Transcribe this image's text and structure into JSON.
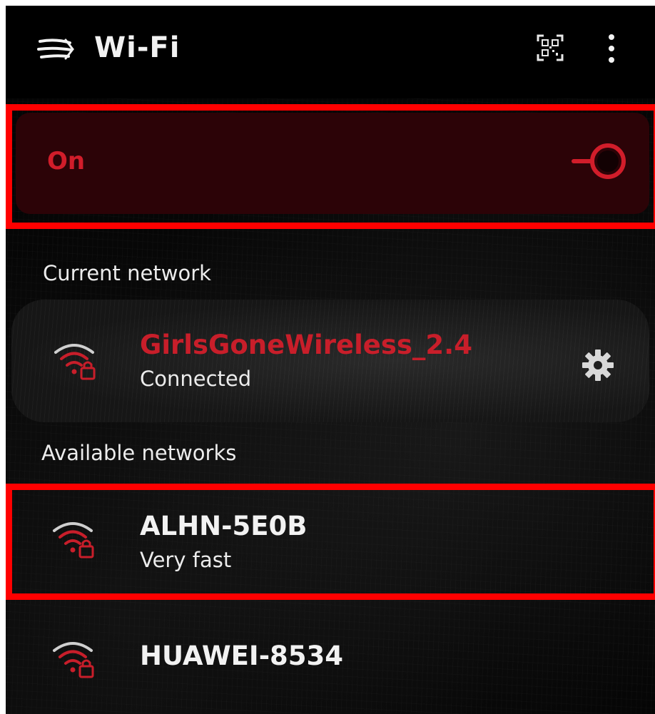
{
  "header": {
    "title": "Wi-Fi",
    "menu_icon": "menu-icon",
    "qr_icon": "qr-code-scan-icon",
    "more_icon": "more-vertical-icon"
  },
  "toggle": {
    "label": "On",
    "state": "on",
    "accent_color": "#d11d2a",
    "panel_color": "#2c0307"
  },
  "sections": {
    "current": "Current network",
    "available": "Available networks"
  },
  "current_network": {
    "name": "GirlsGoneWireless_2.4",
    "status": "Connected",
    "name_color": "#c81e2a",
    "icon": "wifi-lock-icon",
    "settings_icon": "gear-icon"
  },
  "available_networks": [
    {
      "name": "ALHN-5E0B",
      "status": "Very fast",
      "icon": "wifi-lock-icon"
    },
    {
      "name": "HUAWEI-8534",
      "status": "",
      "icon": "wifi-lock-icon"
    }
  ],
  "highlight_color": "#ff0000"
}
